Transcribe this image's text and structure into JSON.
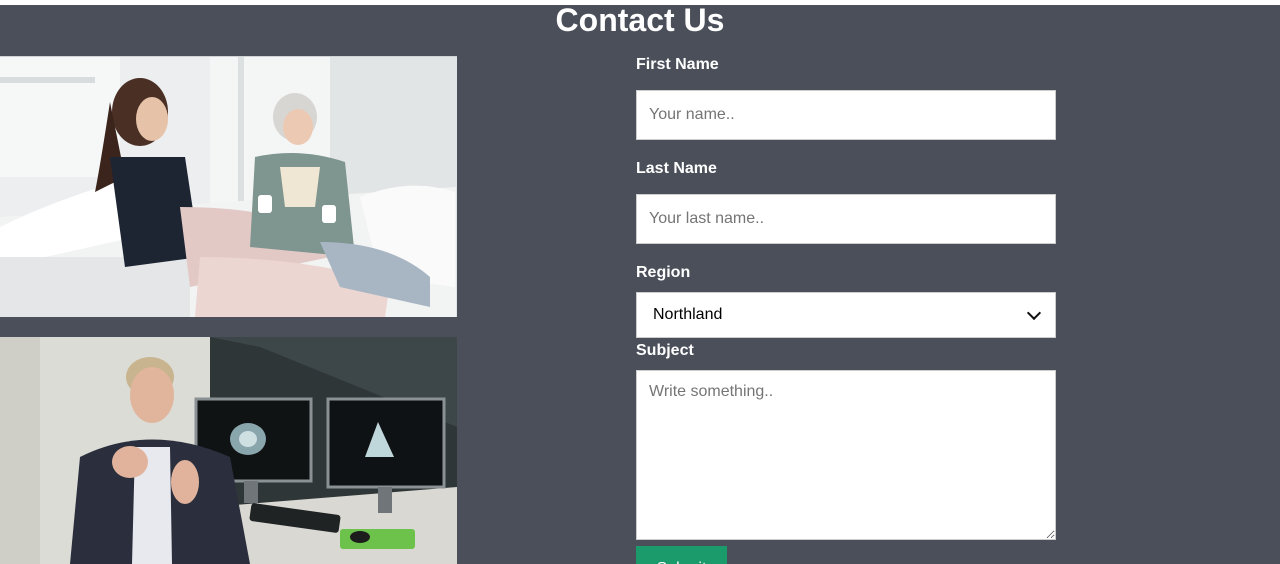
{
  "page": {
    "title": "Contact Us"
  },
  "form": {
    "first_name": {
      "label": "First Name",
      "placeholder": "Your name.."
    },
    "last_name": {
      "label": "Last Name",
      "placeholder": "Your last name.."
    },
    "region": {
      "label": "Region",
      "selected": "Northland"
    },
    "subject": {
      "label": "Subject",
      "placeholder": "Write something.."
    },
    "submit_label": "Submit"
  },
  "colors": {
    "background": "#4a4f5a",
    "submit_button": "#1b9a6c",
    "text": "#ffffff"
  }
}
